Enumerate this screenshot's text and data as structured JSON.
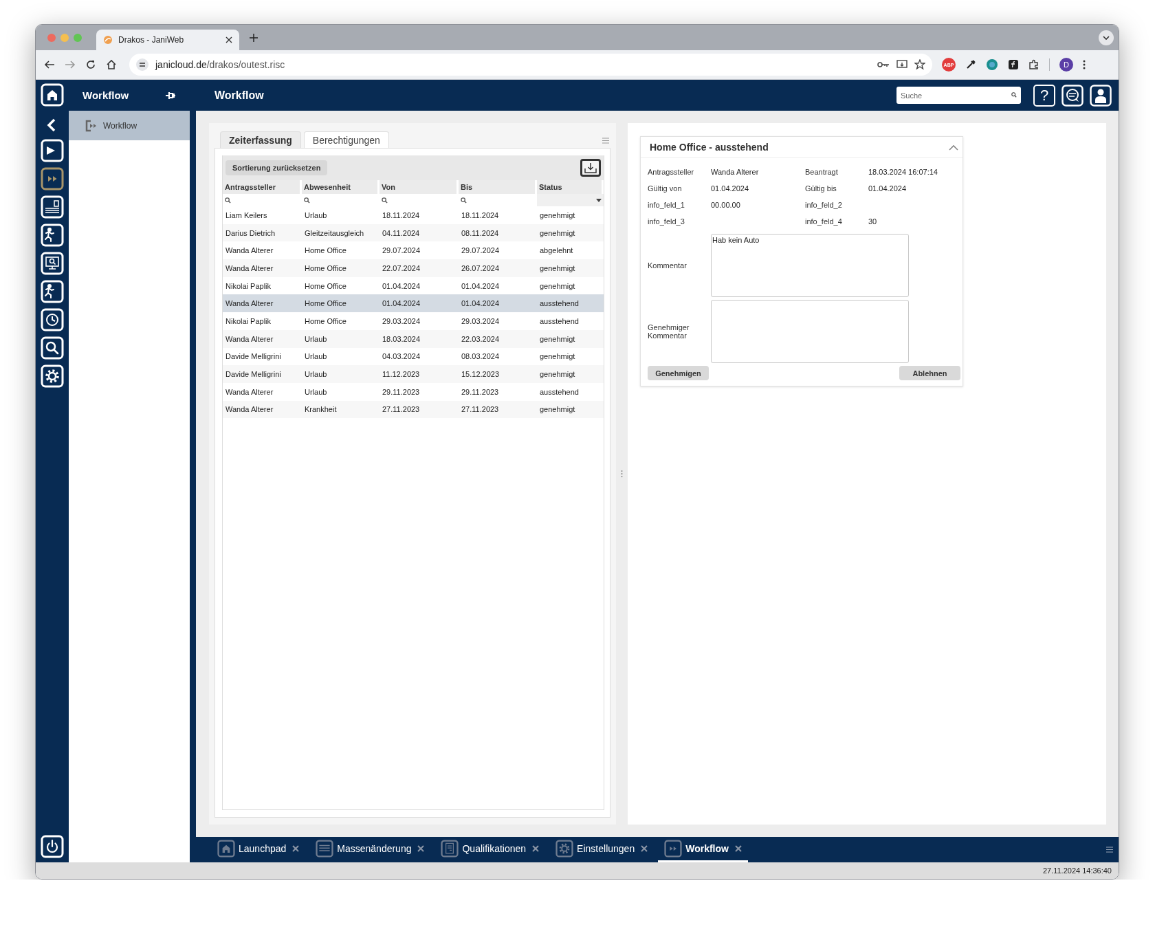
{
  "browser": {
    "tab_title": "Drakos - JaniWeb",
    "url_host": "janicloud.de",
    "url_path": "/drakos/outest.risc",
    "adblock_label": "ABP",
    "profile_initial": "D"
  },
  "rail": [
    {
      "kind": "home",
      "selected": false
    },
    {
      "kind": "back",
      "selected": false
    },
    {
      "kind": "play",
      "selected": false
    },
    {
      "kind": "forward",
      "selected": true
    },
    {
      "kind": "idcard",
      "selected": false
    },
    {
      "kind": "runner",
      "selected": false
    },
    {
      "kind": "monitor",
      "selected": false
    },
    {
      "kind": "runner",
      "selected": false
    },
    {
      "kind": "clock",
      "selected": false
    },
    {
      "kind": "search",
      "selected": false
    },
    {
      "kind": "gear",
      "selected": false
    },
    {
      "kind": "power",
      "selected": false
    }
  ],
  "side_panel": {
    "title": "Workflow",
    "items": [
      {
        "label": "Workflow",
        "selected": true
      }
    ]
  },
  "header": {
    "title": "Workflow",
    "search": {
      "placeholder": "Suche"
    },
    "help_label": "?"
  },
  "content_tabs": [
    {
      "label": "Zeiterfassung",
      "selected": true
    },
    {
      "label": "Berechtigungen",
      "selected": false
    }
  ],
  "table": {
    "reset_button": "Sortierung zurücksetzen",
    "columns": [
      {
        "label": "Antragssteller",
        "kind": "search"
      },
      {
        "label": "Abwesenheit",
        "kind": "search"
      },
      {
        "label": "Von",
        "kind": "search"
      },
      {
        "label": "Bis",
        "kind": "search"
      },
      {
        "label": "Status",
        "kind": "select"
      }
    ],
    "rows": [
      {
        "cells": [
          "Liam Keilers",
          "Urlaub",
          "18.11.2024",
          "18.11.2024",
          "genehmigt"
        ],
        "selected": false
      },
      {
        "cells": [
          "Darius Dietrich",
          "Gleitzeitausgleich",
          "04.11.2024",
          "08.11.2024",
          "genehmigt"
        ],
        "selected": false
      },
      {
        "cells": [
          "Wanda Alterer",
          "Home Office",
          "29.07.2024",
          "29.07.2024",
          "abgelehnt"
        ],
        "selected": false
      },
      {
        "cells": [
          "Wanda Alterer",
          "Home Office",
          "22.07.2024",
          "26.07.2024",
          "genehmigt"
        ],
        "selected": false
      },
      {
        "cells": [
          "Nikolai Paplik",
          "Home Office",
          "01.04.2024",
          "01.04.2024",
          "genehmigt"
        ],
        "selected": false
      },
      {
        "cells": [
          "Wanda Alterer",
          "Home Office",
          "01.04.2024",
          "01.04.2024",
          "ausstehend"
        ],
        "selected": true
      },
      {
        "cells": [
          "Nikolai Paplik",
          "Home Office",
          "29.03.2024",
          "29.03.2024",
          "ausstehend"
        ],
        "selected": false
      },
      {
        "cells": [
          "Wanda Alterer",
          "Urlaub",
          "18.03.2024",
          "22.03.2024",
          "genehmigt"
        ],
        "selected": false
      },
      {
        "cells": [
          "Davide Melligrini",
          "Urlaub",
          "04.03.2024",
          "08.03.2024",
          "genehmigt"
        ],
        "selected": false
      },
      {
        "cells": [
          "Davide Melligrini",
          "Urlaub",
          "11.12.2023",
          "15.12.2023",
          "genehmigt"
        ],
        "selected": false
      },
      {
        "cells": [
          "Wanda Alterer",
          "Urlaub",
          "29.11.2023",
          "29.11.2023",
          "ausstehend"
        ],
        "selected": false
      },
      {
        "cells": [
          "Wanda Alterer",
          "Krankheit",
          "27.11.2023",
          "27.11.2023",
          "genehmigt"
        ],
        "selected": false
      }
    ]
  },
  "detail": {
    "title": "Home Office - ausstehend",
    "fields": [
      {
        "label": "Antragssteller",
        "value": "Wanda Alterer"
      },
      {
        "label": "Beantragt",
        "value": "18.03.2024 16:07:14"
      },
      {
        "label": "Gültig von",
        "value": "01.04.2024"
      },
      {
        "label": "Gültig bis",
        "value": "01.04.2024"
      },
      {
        "label": "info_feld_1",
        "value": "00.00.00"
      },
      {
        "label": "info_feld_2"
      },
      {
        "label": "info_feld_3"
      },
      {
        "label": "info_feld_4",
        "value": "30"
      }
    ],
    "comment": {
      "label": "Kommentar",
      "value": "Hab kein Auto"
    },
    "approver_comment": {
      "label": "Genehmiger Kommentar"
    },
    "approve_button": "Genehmigen",
    "reject_button": "Ablehnen"
  },
  "bottom_tabs": [
    {
      "label": "Launchpad",
      "kind": "home",
      "selected": false
    },
    {
      "label": "Massenänderung",
      "kind": "table",
      "selected": false
    },
    {
      "label": "Qualifikationen",
      "kind": "document",
      "selected": false
    },
    {
      "label": "Einstellungen",
      "kind": "gear",
      "selected": false
    },
    {
      "label": "Workflow",
      "kind": "forward",
      "selected": true
    }
  ],
  "status_time": "27.11.2024 14:36:40"
}
